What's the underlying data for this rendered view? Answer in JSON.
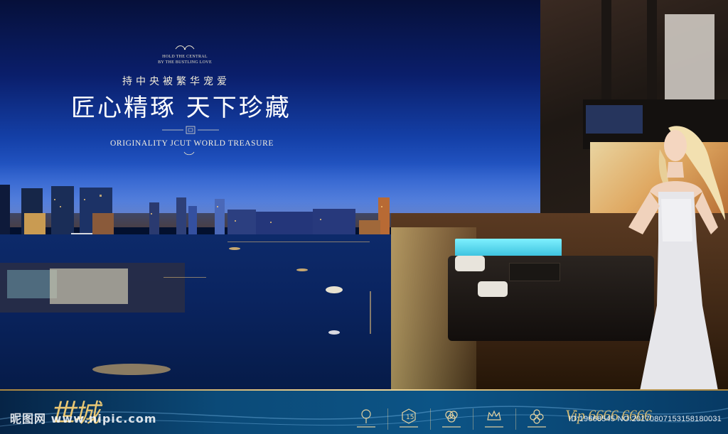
{
  "headline": {
    "tag_line_1": "HOLD THE CENTRAL",
    "tag_line_2": "BY THE BUSTLING LOVE",
    "subtitle_cn": "持中央被繁华宠爱",
    "title_cn": "匠心精琢  天下珍藏",
    "title_en": "ORIGINALITY JCUT WORLD TREASURE"
  },
  "footer": {
    "brand_calligraphy": "世城",
    "watermark_left": "昵图网 www.nipic.com",
    "phone_script": "Vip 6666 6666",
    "watermark_right": "ID:19668545 NO:20170807153158180031",
    "logos": [
      "tree-logo-icon",
      "number-logo-icon",
      "rings-logo-icon",
      "crown-logo-icon",
      "flower-logo-icon"
    ]
  },
  "colors": {
    "gold": "#e9c774",
    "sky_top": "#06103a",
    "band": "#0b4a78"
  }
}
